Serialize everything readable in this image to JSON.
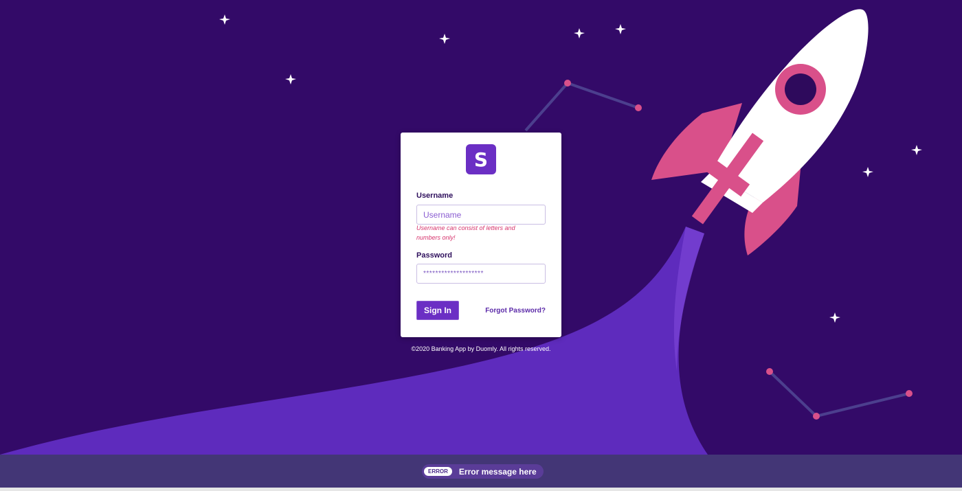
{
  "colors": {
    "background": "#330a68",
    "accent": "#6b2fc4",
    "trail": "#5e2bbd",
    "rocket_pink": "#d9508a",
    "error_bar": "#433676"
  },
  "logo": {
    "letter": "S"
  },
  "login": {
    "username_label": "Username",
    "username_placeholder": "Username",
    "username_hint": "Username can consist of letters and numbers only!",
    "password_label": "Password",
    "password_value": "********************",
    "sign_in_label": "Sign In",
    "forgot_password_label": "Forgot Password?"
  },
  "copyright": "©2020 Banking App by Duomly. All rights reserved.",
  "error_bar": {
    "badge": "ERROR",
    "message": "Error message here"
  }
}
